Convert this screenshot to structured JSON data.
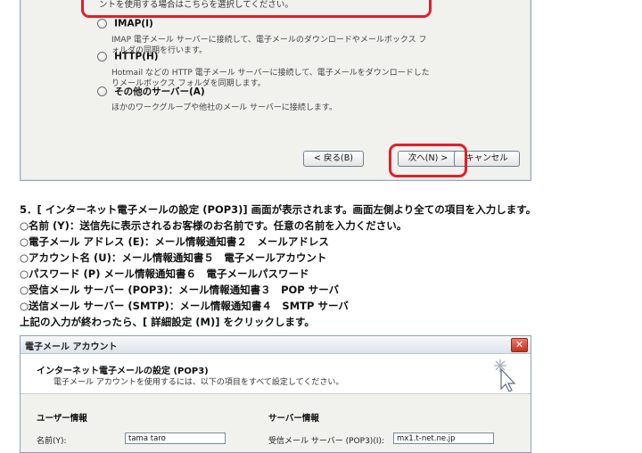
{
  "top_dialog": {
    "highlight_text": "ントを使用する場合はこちらを選択してください。",
    "options": [
      {
        "label": "IMAP(I)",
        "desc": "IMAP 電子メール サーバーに接続して、電子メールのダウンロードやメールボックス フォルダの同期を行います。"
      },
      {
        "label": "HTTP(H)",
        "desc": "Hotmail などの HTTP 電子メール サーバーに接続して、電子メールをダウンロードしたりメールボックス フォルダを同期します。"
      },
      {
        "label": "その他のサーバー(A)",
        "desc": "ほかのワークグループや他社のメール サーバーに接続します。"
      }
    ],
    "buttons": {
      "back": "< 戻る(B)",
      "next": "次へ(N) >",
      "cancel": "キャンセル"
    }
  },
  "instructions": [
    "5．[ インターネット電子メールの設定 (POP3)] 画面が表示されます。画面左側より全ての項目を入力します。",
    "○名前 (Y)：送信先に表示されるお客様のお名前です。任意の名前を入力ください。",
    "○電子メール アドレス (E)：メール情報通知書２　メールアドレス",
    "○アカウント名 (U)：メール情報通知書５　電子メールアカウント",
    "○パスワード (P) メール情報通知書６　電子メールパスワード",
    "○受信メール サーバー (POP3)：メール情報通知書３　POP サーバ",
    "○送信メール サーバー (SMTP)：メール情報通知書４　SMTP サーバ",
    "上記の入力が終わったら、[ 詳細設定 (M)] をクリックします。"
  ],
  "bottom_dialog": {
    "title": "電子メール アカウント",
    "close": "✕",
    "header_title": "インターネット電子メールの設定 (POP3)",
    "header_sub": "電子メール アカウントを使用するには、以下の項目をすべて設定してください。",
    "user_section": "ユーザー情報",
    "server_section": "サーバー情報",
    "name_label": "名前(Y):",
    "name_value": "tama taro",
    "incoming_label": "受信メール サーバー (POP3)(I):",
    "incoming_value": "mx1.t-net.ne.jp"
  }
}
